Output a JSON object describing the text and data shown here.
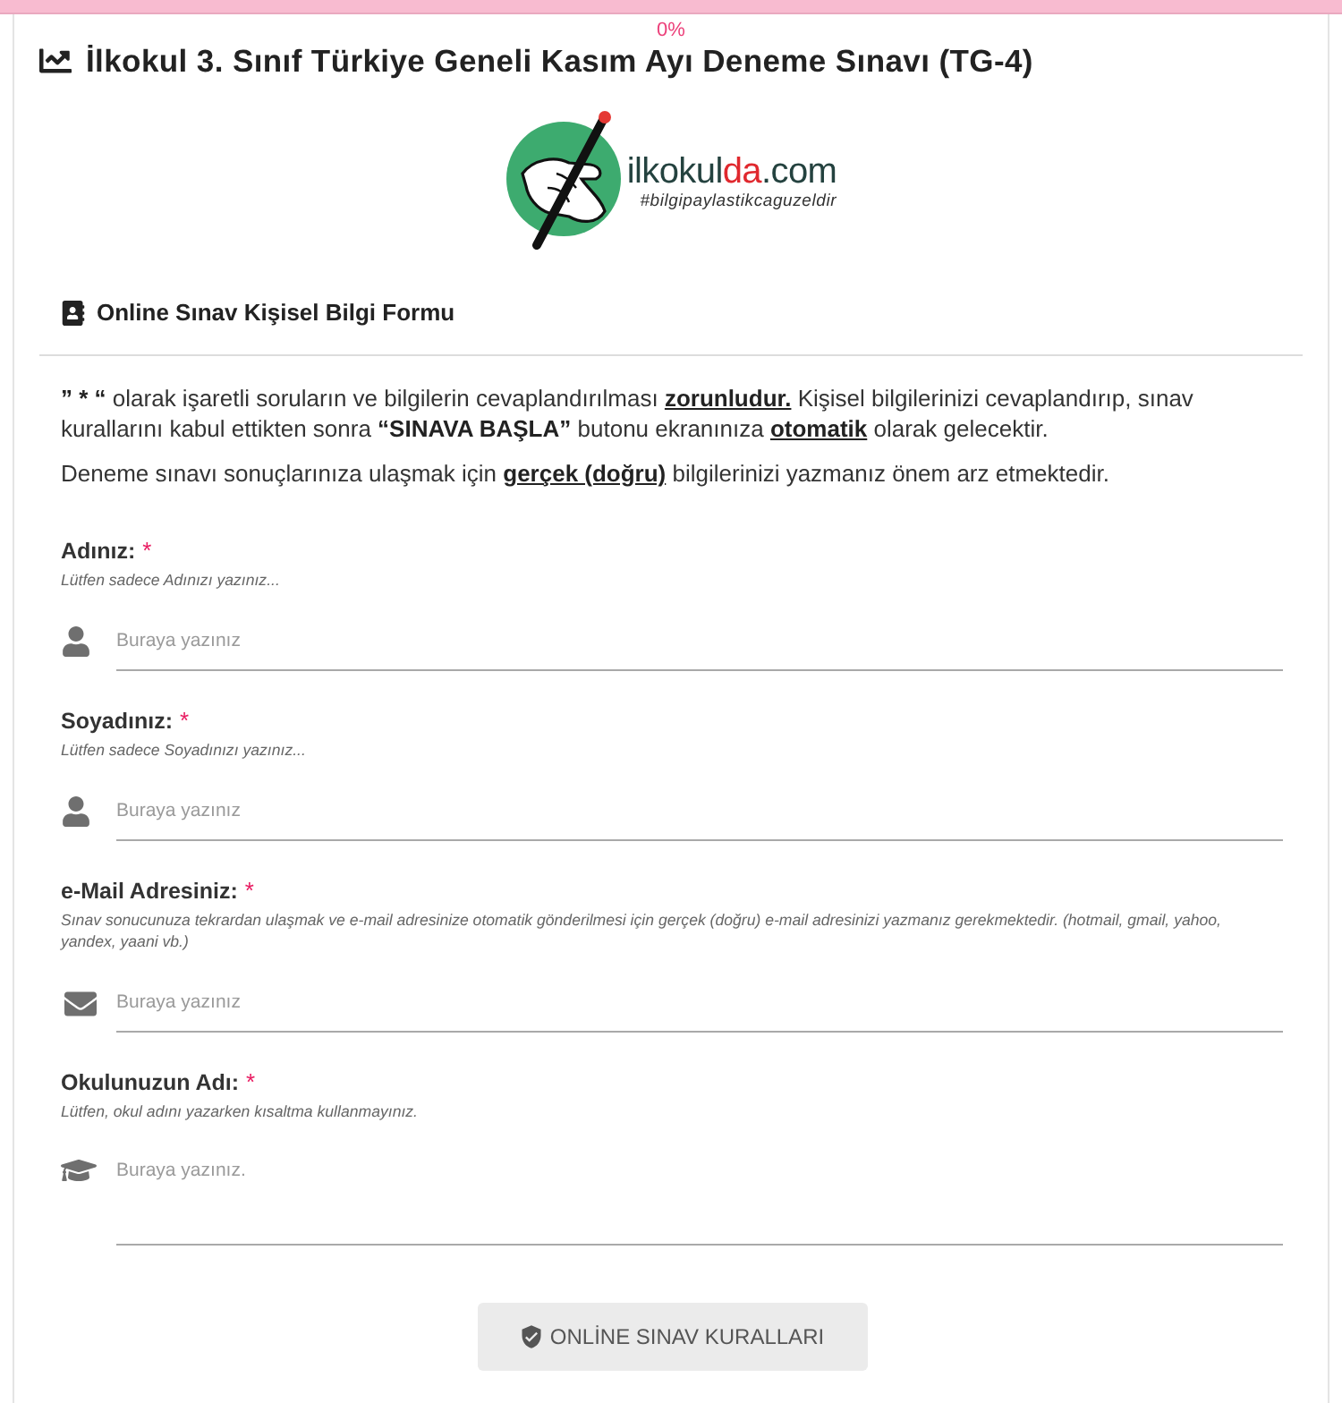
{
  "progress": {
    "level": 0,
    "reading": "0%"
  },
  "title": "İlkokul 3. Sınıf Türkiye Geneli Kasım Ayı Deneme Sınavı (TG-4)",
  "logo": {
    "name": "ilkokul",
    "accent": "da",
    "domain": ".com",
    "tagline": "#bilgipaylastikcaguzeldir"
  },
  "section": {
    "title": "Online Sınav Kişisel Bilgi Formu"
  },
  "intro": [
    {
      "segments": [
        {
          "kind": "bold",
          "text": "” * “"
        },
        {
          "kind": "plain",
          "text": " olarak işaretli soruların ve bilgilerin cevaplandırılması "
        },
        {
          "kind": "underlined",
          "text": "zorunludur."
        },
        {
          "kind": "plain",
          "text": " Kişisel bilgilerinizi cevaplandırıp, sınav kurallarını kabul ettikten sonra "
        },
        {
          "kind": "bold",
          "text": "“SINAVA BAŞLA”"
        },
        {
          "kind": "plain",
          "text": " butonu ekranınıza "
        },
        {
          "kind": "underlined",
          "text": "otomatik"
        },
        {
          "kind": "plain",
          "text": " olarak gelecektir."
        }
      ]
    },
    {
      "segments": [
        {
          "kind": "plain",
          "text": "Deneme sınavı sonuçlarınıza ulaşmak için "
        },
        {
          "kind": "underlined",
          "text": "gerçek (doğru)"
        },
        {
          "kind": "plain",
          "text": " bilgilerinizi yazmanız önem arz etmektedir."
        }
      ]
    }
  ],
  "required_mark": "*",
  "fields": [
    {
      "kind": "text",
      "label": "Adınız:",
      "required": true,
      "hint": "Lütfen sadece Adınızı yazınız...",
      "placeholder": "Buraya yazınız"
    },
    {
      "kind": "text",
      "label": "Soyadınız:",
      "required": true,
      "hint": "Lütfen sadece Soyadınızı yazınız...",
      "placeholder": "Buraya yazınız"
    },
    {
      "kind": "email",
      "label": "e-Mail Adresiniz:",
      "required": true,
      "hint": "Sınav sonucunuza tekrardan ulaşmak ve e-mail adresinize otomatik gönderilmesi için gerçek (doğru) e-mail adresinizi yazmanız gerekmektedir. (hotmail, gmail, yahoo, yandex, yaani vb.)",
      "placeholder": "Buraya yazınız"
    },
    {
      "kind": "textarea",
      "label": "Okulunuzun Adı:",
      "required": true,
      "hint": "Lütfen, okul adını yazarken kısaltma kullanmayınız.",
      "placeholder": "Buraya yazınız."
    }
  ],
  "rules_button": {
    "label": "ONLİNE SINAV KURALLARI"
  }
}
